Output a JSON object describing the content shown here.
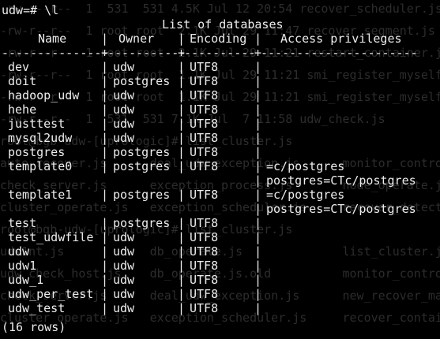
{
  "terminal": {
    "prompt": "udw=# \\l",
    "table_title": "List of databases",
    "headers": {
      "name": "Name",
      "owner": "Owner",
      "encoding": "Encoding",
      "access": "Access privileges"
    },
    "rule": {
      "name": "---------------",
      "owner": "-----------",
      "encoding": "----------",
      "access": "----------------------"
    },
    "separator": "|",
    "rows": [
      {
        "name": "dev",
        "owner": "udw",
        "encoding": "UTF8",
        "access": ""
      },
      {
        "name": "doit",
        "owner": "postgres",
        "encoding": "UTF8",
        "access": ""
      },
      {
        "name": "hadoop_udw",
        "owner": "udw",
        "encoding": "UTF8",
        "access": ""
      },
      {
        "name": "hehe",
        "owner": "udw",
        "encoding": "UTF8",
        "access": ""
      },
      {
        "name": "justtest",
        "owner": "udw",
        "encoding": "UTF8",
        "access": ""
      },
      {
        "name": "mysql2udw",
        "owner": "udw",
        "encoding": "UTF8",
        "access": ""
      },
      {
        "name": "postgres",
        "owner": "postgres",
        "encoding": "UTF8",
        "access": ""
      },
      {
        "name": "template0",
        "owner": "postgres",
        "encoding": "UTF8",
        "access": "=c/postgres"
      },
      {
        "name": "",
        "owner": "",
        "encoding": "",
        "access": "postgres=CTc/postgres",
        "continuation": true
      },
      {
        "name": "template1",
        "owner": "postgres",
        "encoding": "UTF8",
        "access": "=c/postgres"
      },
      {
        "name": "",
        "owner": "",
        "encoding": "",
        "access": "postgres=CTc/postgres",
        "continuation": true
      },
      {
        "name": "test",
        "owner": "postgres",
        "encoding": "UTF8",
        "access": ""
      },
      {
        "name": "test_udwfile",
        "owner": "udw",
        "encoding": "UTF8",
        "access": ""
      },
      {
        "name": "udw",
        "owner": "udw",
        "encoding": "UTF8",
        "access": ""
      },
      {
        "name": "udw1",
        "owner": "udw",
        "encoding": "UTF8",
        "access": ""
      },
      {
        "name": "udw_1",
        "owner": "udw",
        "encoding": "UTF8",
        "access": ""
      },
      {
        "name": "udw_per_test",
        "owner": "udw",
        "encoding": "UTF8",
        "access": ""
      },
      {
        "name": "udw_test",
        "owner": "udw",
        "encoding": "UTF8",
        "access": ""
      }
    ],
    "footer": "(16 rows)",
    "background_echo": [
      "-rw-r--r--  1  531  531 4.5K Jul 12 20:54 recover_scheduler.js",
      "-rw-r--r--  1 root root  2.1K Jul 29 11:47 recover_segment.js",
      "-rw-r--r--  1 root root  2.1K Jul 29 11:21 restart_container.js",
      "-rw-r--r--  1 root root  1.1K Jul 29 11:21 smi_register_myself.js",
      "-rw-r--r--  1 root root  1.1K Jul 29 11:21 smi_register_myself.js",
      "-rw-r--r--  1  531  531 7.1K Jul  7 11:58 udw_check.js",
      "root@bgb-udw-[uprologic]# list_cluster.js",
      "auto_recover.js      deal_udw_exception.js      monitor_control",
      "check_server.js      exception_process.js       node_operate.js",
      "cluster_operate.js   exception_scheduler.js     recover_detect.",
      "root@bgb-udw-[uprologic]# list_cluster.js",
      "udw1nt.js            db_operate.js              list_cluster.js",
      "udw_check_host.js    db_operate.js.old          monitor_control",
      "check_server.js      deal_udw_exception.js      new_recover_mas",
      "cluster_operate.js   exception_scheduler.js     recover_contain"
    ]
  }
}
